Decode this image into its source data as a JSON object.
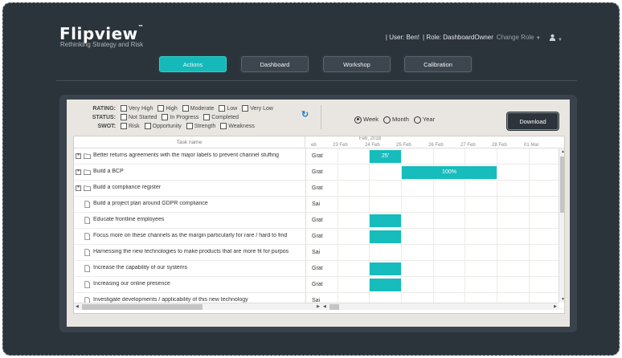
{
  "brand": {
    "name": "Flipview",
    "trademark": "™",
    "tagline": "Rethinking Strategy and Risk"
  },
  "user": {
    "user_label": "| User: Ben!",
    "role_label": "| Role: DashboardOwner",
    "change_role": "Change Role"
  },
  "nav": {
    "tabs": [
      {
        "label": "Actions",
        "active": true
      },
      {
        "label": "Dashboard",
        "active": false
      },
      {
        "label": "Workshop",
        "active": false
      },
      {
        "label": "Calibration",
        "active": false
      }
    ]
  },
  "filters": {
    "rating": {
      "label": "RATING:",
      "options": [
        "Very High",
        "High",
        "Moderate",
        "Low",
        "Very Low"
      ]
    },
    "status": {
      "label": "STATUS:",
      "options": [
        "Not Started",
        "In Progress",
        "Completed"
      ]
    },
    "swot": {
      "label": "SWOT:",
      "options": [
        "Risk",
        "Opportunity",
        "Strength",
        "Weakness"
      ]
    }
  },
  "view": {
    "options": [
      "Week",
      "Month",
      "Year"
    ],
    "selected": "Week"
  },
  "download_label": "Download",
  "grid": {
    "task_header": "Task name",
    "month": "Feb, 2018",
    "days": [
      "eb",
      "23 Feb",
      "24 Feb",
      "25 Feb",
      "26 Feb",
      "27 Feb",
      "28 Feb",
      "01 Mar"
    ],
    "rows": [
      {
        "name": "Better returns agreements with the major labels to prevent channel stuffing",
        "col2": "Grat",
        "type": "folder",
        "expand": "+"
      },
      {
        "name": "Build a BCP",
        "col2": "Grat",
        "type": "folder",
        "expand": "+"
      },
      {
        "name": "Build a compliance register",
        "col2": "Grat",
        "type": "folder",
        "expand": "+"
      },
      {
        "name": "Build a project plan around GDPR compliance",
        "col2": "Sai",
        "type": "file"
      },
      {
        "name": "Educate frontline employees",
        "col2": "Grat",
        "type": "file"
      },
      {
        "name": "Focus more on these channels as the margin particularly for rare / hard to find",
        "col2": "Grat",
        "type": "file"
      },
      {
        "name": "Harnessing the new technologies to make products that are more fit for purpos",
        "col2": "Sai",
        "type": "file"
      },
      {
        "name": "Increase the capability of our systems",
        "col2": "Grat",
        "type": "file"
      },
      {
        "name": "Increasing our online presence",
        "col2": "Grat",
        "type": "file"
      },
      {
        "name": "Investigate developments / applicability of this new technology",
        "col2": "Sai",
        "type": "file"
      }
    ],
    "bars": [
      {
        "label": "25'"
      },
      {
        "label": "100%"
      }
    ]
  },
  "colors": {
    "accent": "#17bcbc",
    "background": "#2b333b"
  }
}
